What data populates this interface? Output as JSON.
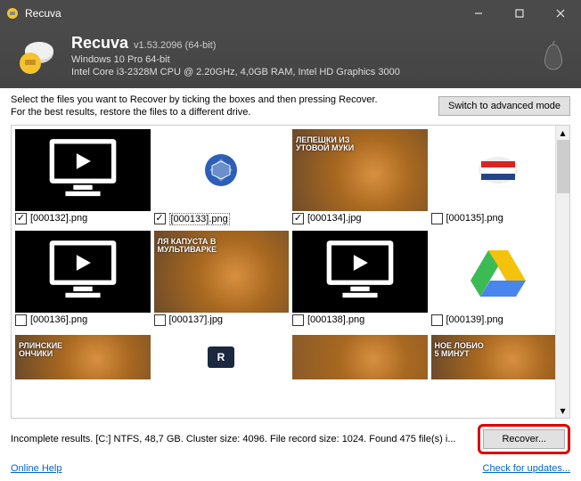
{
  "window": {
    "title": "Recuva"
  },
  "header": {
    "app_name": "Recuva",
    "version": "v1.53.2096 (64-bit)",
    "os": "Windows 10 Pro 64-bit",
    "hw": "Intel Core i3-2328M CPU @ 2.20GHz, 4,0GB RAM, Intel HD Graphics 3000"
  },
  "instructions": {
    "line1": "Select the files you want to Recover by ticking the boxes and then pressing Recover.",
    "line2": "For the best results, restore the files to a different drive."
  },
  "buttons": {
    "advanced": "Switch to advanced mode",
    "recover": "Recover..."
  },
  "files": [
    {
      "name": "[000132].png",
      "checked": true,
      "kind": "video"
    },
    {
      "name": "[000133].png",
      "checked": true,
      "kind": "logo-blue",
      "selected": true
    },
    {
      "name": "[000134].jpg",
      "checked": true,
      "kind": "food",
      "overlay": "ЛЕПЕШКИ ИЗ\nУТОВОЙ МУКИ"
    },
    {
      "name": "[000135].png",
      "checked": false,
      "kind": "flag"
    },
    {
      "name": "[000136].png",
      "checked": false,
      "kind": "video"
    },
    {
      "name": "[000137].jpg",
      "checked": false,
      "kind": "food",
      "overlay": "ЛЯ КАПУСТА В\nМУЛЬТИВАРКЕ"
    },
    {
      "name": "[000138].png",
      "checked": false,
      "kind": "video"
    },
    {
      "name": "[000139].png",
      "checked": false,
      "kind": "gdrive"
    }
  ],
  "partial": [
    {
      "kind": "food",
      "overlay": "РЛИНСКИЕ\nОНЧИКИ"
    },
    {
      "kind": "logo-dark"
    },
    {
      "kind": "food-plain"
    },
    {
      "kind": "food",
      "overlay": "НОЕ ЛОБИО\n5 МИНУТ"
    }
  ],
  "status": "Incomplete results. [C:] NTFS, 48,7 GB. Cluster size: 4096. File record size: 1024. Found 475 file(s) i...",
  "footer": {
    "help": "Online Help",
    "updates": "Check for updates..."
  }
}
